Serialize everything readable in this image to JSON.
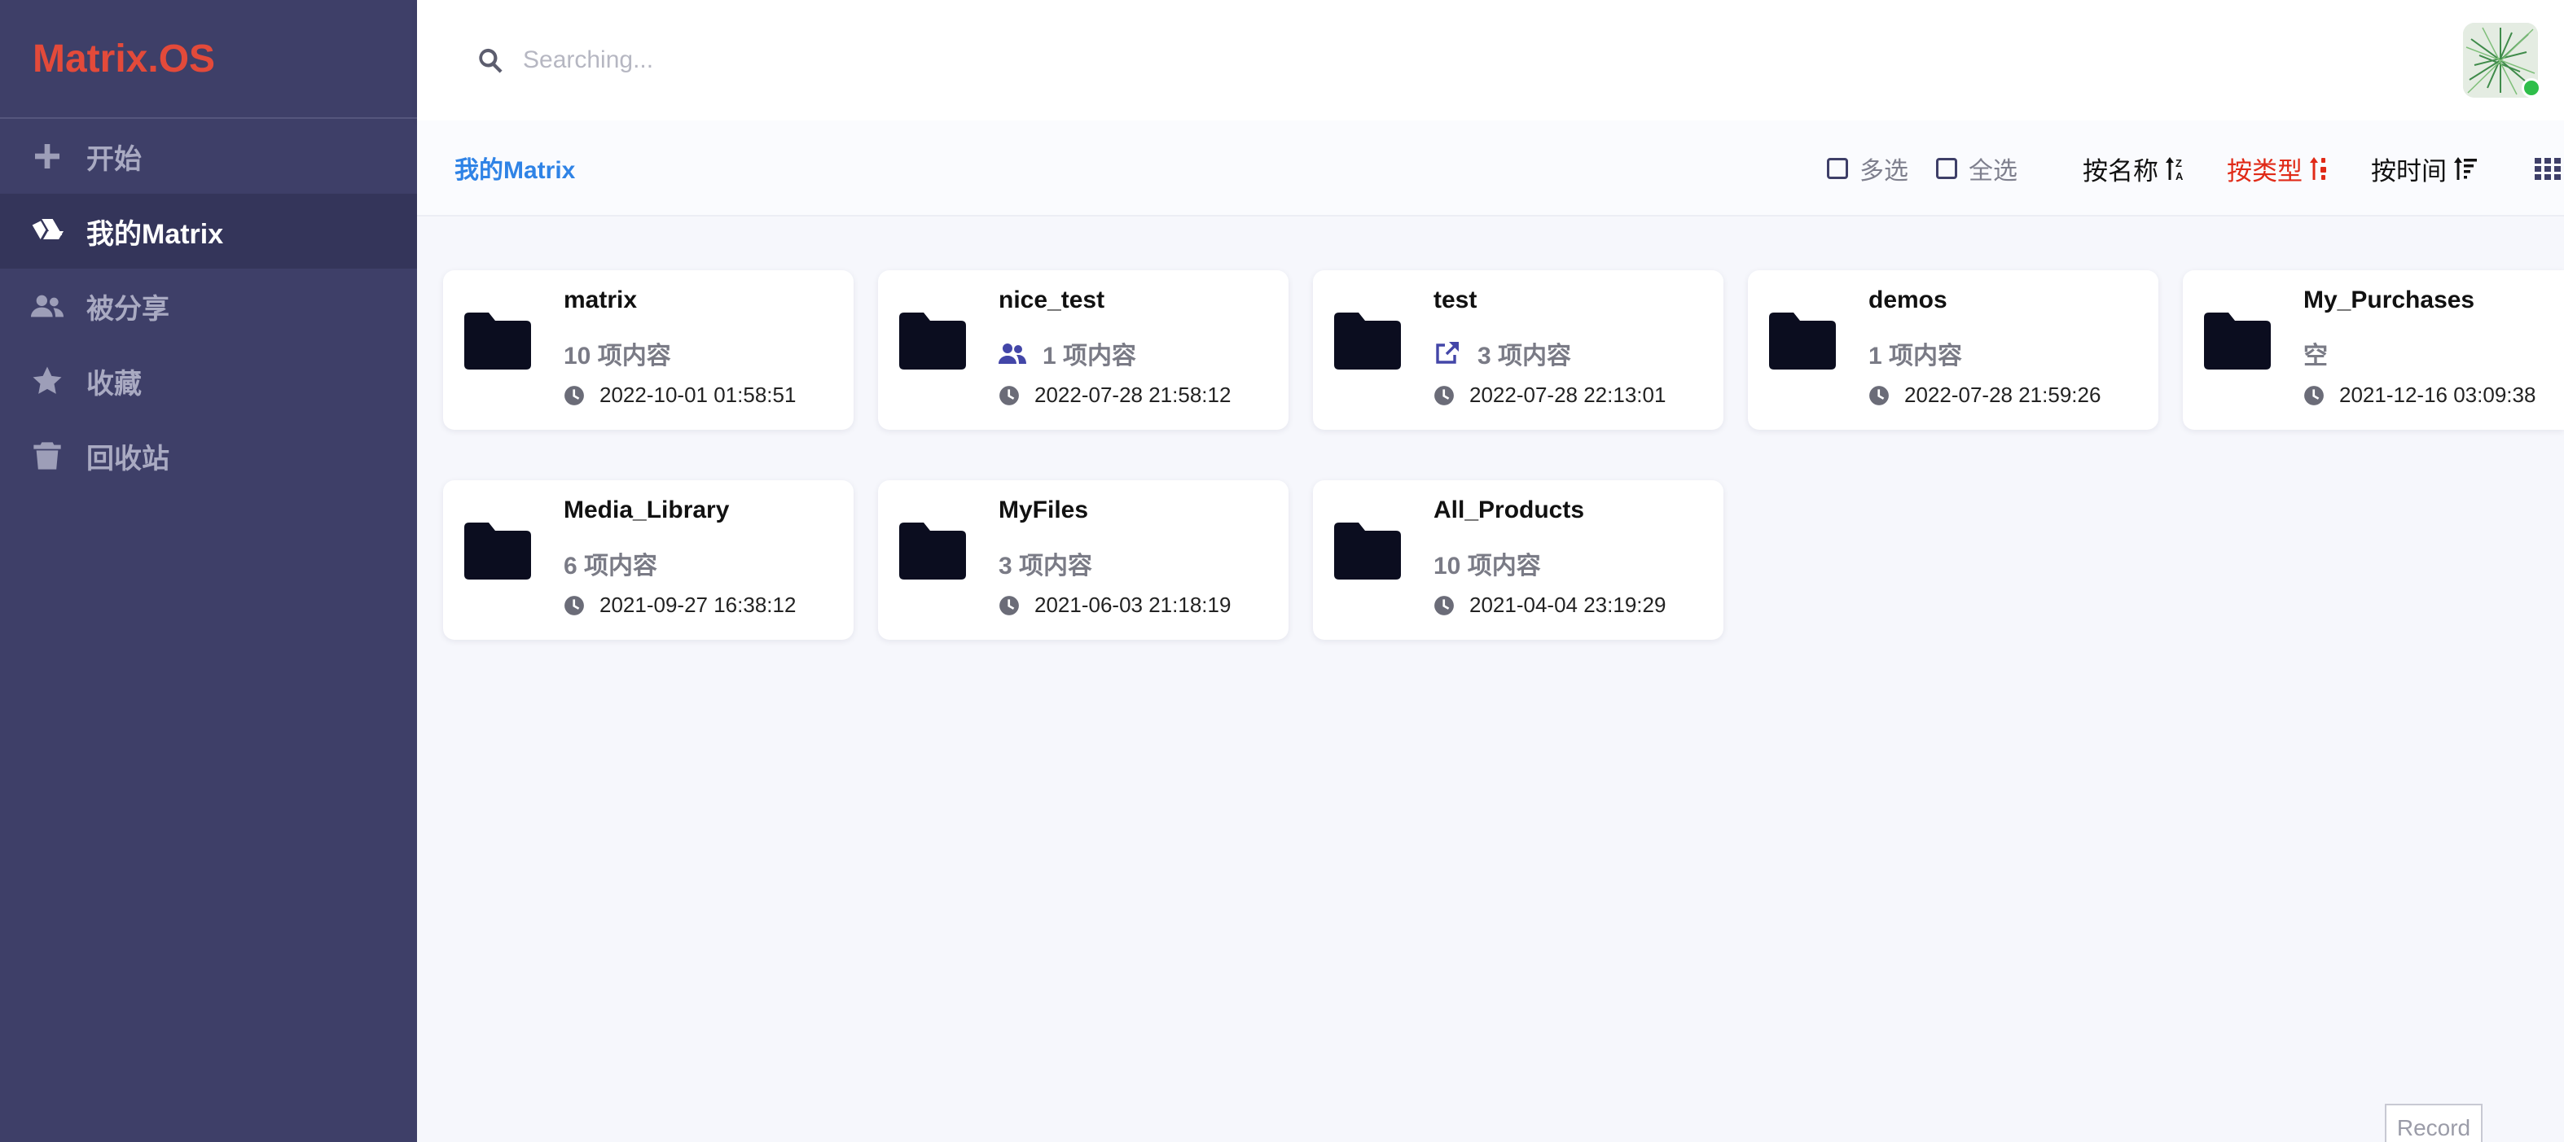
{
  "app": {
    "logo": "Matrix.OS"
  },
  "sidebar": {
    "items": [
      {
        "label": "开始",
        "icon": "plus-icon"
      },
      {
        "label": "我的Matrix",
        "icon": "drive-icon",
        "active": true
      },
      {
        "label": "被分享",
        "icon": "users-icon"
      },
      {
        "label": "收藏",
        "icon": "star-icon"
      },
      {
        "label": "回收站",
        "icon": "trash-icon"
      }
    ]
  },
  "search": {
    "placeholder": "Searching..."
  },
  "toolbar": {
    "breadcrumb": "我的Matrix",
    "multi_select": "多选",
    "select_all": "全选",
    "sort_by_name": "按名称",
    "sort_by_type": "按类型",
    "sort_by_time": "按时间"
  },
  "colors": {
    "accent": "#2f83e6",
    "active_sort": "#e02a17",
    "logo": "#e34a3a",
    "sidebar": "#3e3f68"
  },
  "folders": [
    {
      "name": "matrix",
      "meta": "10 项内容",
      "meta_icon": "",
      "time": "2022-10-01 01:58:51"
    },
    {
      "name": "nice_test",
      "meta": "1 项内容",
      "meta_icon": "users-icon",
      "time": "2022-07-28 21:58:12"
    },
    {
      "name": "test",
      "meta": "3 项内容",
      "meta_icon": "external-link-icon",
      "time": "2022-07-28 22:13:01"
    },
    {
      "name": "demos",
      "meta": "1 项内容",
      "meta_icon": "",
      "time": "2022-07-28 21:59:26"
    },
    {
      "name": "My_Purchases",
      "meta": "空",
      "meta_icon": "",
      "time": "2021-12-16 03:09:38"
    },
    {
      "name": "Media_Library",
      "meta": "6 项内容",
      "meta_icon": "",
      "time": "2021-09-27 16:38:12"
    },
    {
      "name": "MyFiles",
      "meta": "3 项内容",
      "meta_icon": "",
      "time": "2021-06-03 21:18:19"
    },
    {
      "name": "All_Products",
      "meta": "10 项内容",
      "meta_icon": "",
      "time": "2021-04-04 23:19:29"
    }
  ],
  "record_button": "Record"
}
